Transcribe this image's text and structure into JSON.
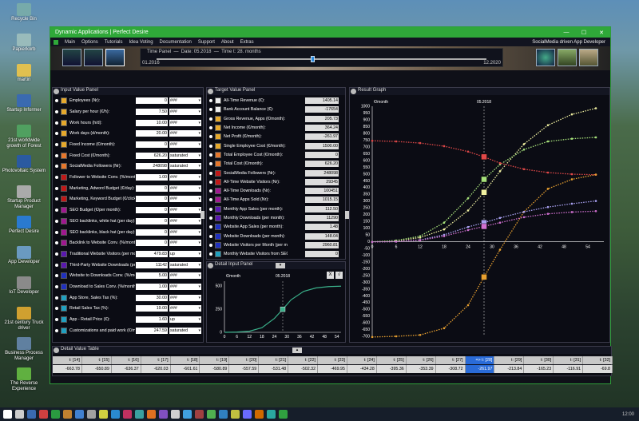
{
  "desktop": {
    "icons": [
      {
        "label": "Recycle Bin",
        "color": "#7aa"
      },
      {
        "label": "Papierkorb",
        "color": "#9bb"
      },
      {
        "label": "martin",
        "color": "#e0c050"
      },
      {
        "label": "Startup Informer",
        "color": "#3a6ab0"
      },
      {
        "label": "21st worldwide growth of Forest",
        "color": "#50a060"
      },
      {
        "label": "Photovoltaic System",
        "color": "#2a5aa0"
      },
      {
        "label": "Startup Product Manager",
        "color": "#aaa"
      },
      {
        "label": "Perfect Desire",
        "color": "#2a7ad0"
      },
      {
        "label": "App Developer",
        "color": "#6a9ac0"
      },
      {
        "label": "IoT Developer",
        "color": "#8a8a8a"
      },
      {
        "label": "21st century Truck driver",
        "color": "#d0a030"
      },
      {
        "label": "Business Process Manager",
        "color": "#6080a0"
      },
      {
        "label": "The Reverse Experience",
        "color": "#60b040"
      }
    ]
  },
  "window": {
    "title": "Dynamic Applications | Perfect Desire",
    "controls": {
      "min": "—",
      "max": "☐",
      "close": "✕"
    }
  },
  "menu": {
    "items": [
      "Main",
      "Options",
      "Tutorials",
      "Idea Voting",
      "Documentation",
      "Support",
      "About",
      "Extras"
    ],
    "right": "SocialMedia driven App Developer"
  },
  "timepanel": {
    "title": "Time Panel",
    "date_label": "Date: 05.2018",
    "time_label": "Time t: 28. months",
    "start": "01.2016",
    "end": "12.2020",
    "progress": 0.47
  },
  "input_panel": {
    "title": "Input Value Panel",
    "rows": [
      {
        "label": "Employees (Nr):",
        "value": "0",
        "select": "###",
        "color": "#e6a92c"
      },
      {
        "label": "Salary per hour (€/h):",
        "value": "7.50",
        "select": "###",
        "color": "#e6a92c"
      },
      {
        "label": "Work hours (h/d):",
        "value": "10.00",
        "select": "###",
        "color": "#e6a92c"
      },
      {
        "label": "Work days (d/month):",
        "value": "20.00",
        "select": "###",
        "color": "#e6a92c"
      },
      {
        "label": "Fixed Income (€/month):",
        "value": "0",
        "select": "###",
        "color": "#e6a92c"
      },
      {
        "label": "Fixed Cost (€/month):",
        "value": "626.20",
        "select": "saturated",
        "color": "#e6772c"
      },
      {
        "label": "SocialMedia Followers (Nr):",
        "value": "248098",
        "select": "saturated",
        "color": "#e6772c"
      },
      {
        "label": "Follower to Website Conv. (%/month):",
        "value": "1.00",
        "select": "###",
        "color": "#c01818"
      },
      {
        "label": "Marketing, Adword Budget (€/day):",
        "value": "0",
        "select": "###",
        "color": "#c01818"
      },
      {
        "label": "Marketing, Keyword Budget (€/click):",
        "value": "0",
        "select": "###",
        "color": "#c01818"
      },
      {
        "label": "SEO Budget (€/per month):",
        "value": "0",
        "select": "###",
        "color": "#a01890"
      },
      {
        "label": "SEO backlinks, white hat (per day):",
        "value": "0",
        "select": "###",
        "color": "#a01890"
      },
      {
        "label": "SEO backlinks, black hat (per day):",
        "value": "0",
        "select": "###",
        "color": "#a01890"
      },
      {
        "label": "Backlink to Website Conv. (%/month):",
        "value": "0",
        "select": "###",
        "color": "#a01890"
      },
      {
        "label": "Traditional Website Visitors (per month):",
        "value": "479.83",
        "select": "up",
        "color": "#5a18b0"
      },
      {
        "label": "Third-Party Website Downloads (per month):",
        "value": "11142",
        "select": "saturated",
        "color": "#5a18b0"
      },
      {
        "label": "Website to Downloads Conv. (%/month):",
        "value": "5.00",
        "select": "###",
        "color": "#2030c0"
      },
      {
        "label": "Download to Sales Conv. (%/month):",
        "value": "1.00",
        "select": "###",
        "color": "#2030c0"
      },
      {
        "label": "App Store, Sales Tax (%):",
        "value": "30.00",
        "select": "###",
        "color": "#20a0c0"
      },
      {
        "label": "Retail Sales Tax (%):",
        "value": "19.00",
        "select": "###",
        "color": "#20a0c0"
      },
      {
        "label": "App - Retail Price (€):",
        "value": "1.60",
        "select": "up",
        "color": "#20a0c0"
      },
      {
        "label": "Customizations and paid work (€/month):",
        "value": "247.59",
        "select": "saturated",
        "color": "#20a0c0"
      }
    ]
  },
  "target_panel": {
    "title": "Target Value Panel",
    "rows": [
      {
        "label": "All-Time Revenue (€):",
        "value": "1405.14",
        "color": "#eeeeee"
      },
      {
        "label": "Bank Account Balance (€):",
        "value": "-17654",
        "color": "#eeeeee"
      },
      {
        "label": "Gross Revenue, Apps (€/month):",
        "value": "205.73",
        "color": "#e6a92c"
      },
      {
        "label": "Net Income (€/month):",
        "value": "364.24",
        "color": "#e6a92c"
      },
      {
        "label": "Net Profit (€/month):",
        "value": "-261.97",
        "color": "#e6a92c"
      },
      {
        "label": "Single Employee Cost (€/month):",
        "value": "1500.00",
        "color": "#e6a92c"
      },
      {
        "label": "Total Employee Cost (€/month):",
        "value": "0",
        "color": "#e6772c"
      },
      {
        "label": "Total Cost (€/month):",
        "value": "626.20",
        "color": "#e6772c"
      },
      {
        "label": "SocialMedia Followers (Nr):",
        "value": "248098",
        "color": "#c01818"
      },
      {
        "label": "All-Time Website Visitors (Nr):",
        "value": "29345",
        "color": "#c01818"
      },
      {
        "label": "All-Time Downloads (Nr):",
        "value": "100451",
        "color": "#a01890"
      },
      {
        "label": "All-Time Apps Sold (Nr):",
        "value": "1015.15",
        "color": "#a01890"
      },
      {
        "label": "Monthly App Sales (per month):",
        "value": "112.50",
        "color": "#5a18b0"
      },
      {
        "label": "Monthly Downloads (per month):",
        "value": "11290",
        "color": "#5a18b0"
      },
      {
        "label": "Website App Sales (per month):",
        "value": "1.48",
        "color": "#2030c0"
      },
      {
        "label": "Website Downloads (per month):",
        "value": "148.04",
        "color": "#2030c0"
      },
      {
        "label": "Website Visitors per Month (per month):",
        "value": "2960.81",
        "color": "#2030c0"
      },
      {
        "label": "Monthly Website Visitors from SEO (Nr):",
        "value": "0",
        "color": "#20a0c0"
      }
    ]
  },
  "detail_input_panel": {
    "title": "Detail Input Panel",
    "ylabel": "€/month",
    "marker_label": "05.2018",
    "x_ticks": [
      "0",
      "6",
      "12",
      "18",
      "24",
      "30",
      "36",
      "42",
      "48",
      "54"
    ],
    "y_ticks": [
      "500",
      "250",
      "0"
    ],
    "btn_x": "X",
    "btn_check": "√"
  },
  "result_graph": {
    "title": "Result Graph",
    "ylabel": "€/month",
    "marker_label": "05.2018",
    "y_ticks": [
      "1000",
      "950",
      "900",
      "850",
      "800",
      "750",
      "700",
      "650",
      "600",
      "550",
      "500",
      "450",
      "400",
      "350",
      "300",
      "250",
      "200",
      "150",
      "100",
      "50",
      "0",
      "-50",
      "-100",
      "-150",
      "-200",
      "-250",
      "-300",
      "-350",
      "-400",
      "-450",
      "-500",
      "-550",
      "-600",
      "-650",
      "-700"
    ],
    "x_ticks": [
      "0",
      "6",
      "12",
      "18",
      "24",
      "30",
      "36",
      "42",
      "48",
      "54"
    ]
  },
  "detail_table": {
    "title": "Detail Value Table",
    "headers": [
      "t: [14]",
      "t: [15]",
      "t: [16]",
      "t: [17]",
      "t: [18]",
      "t: [19]",
      "t: [20]",
      "t: [21]",
      "t: [22]",
      "t: [23]",
      "t: [24]",
      "t: [25]",
      "t: [26]",
      "t: [27]",
      "=> t: [28]",
      "t: [29]",
      "t: [30]",
      "t: [31]",
      "t: [32]"
    ],
    "values": [
      "-663.78",
      "-650.89",
      "-636.37",
      "-620.03",
      "-601.61",
      "-580.89",
      "-557.59",
      "-531.48",
      "-502.32",
      "-469.95",
      "-434.28",
      "-395.36",
      "-353.39",
      "-308.72",
      "-261.97",
      "-213.84",
      "-165.23",
      "-116.91",
      "-69.8"
    ],
    "highlight_index": 14
  },
  "chart_data": {
    "type": "line",
    "title": "Result Graph",
    "ylabel": "€/month",
    "xlabel": "",
    "ylim": [
      -700,
      1000
    ],
    "xlim": [
      0,
      58
    ],
    "marker_x": 28,
    "series": [
      {
        "color": "#f0f0a0",
        "points": [
          [
            0,
            -2
          ],
          [
            6,
            5
          ],
          [
            12,
            30
          ],
          [
            18,
            90
          ],
          [
            24,
            230
          ],
          [
            28,
            364
          ],
          [
            32,
            520
          ],
          [
            38,
            720
          ],
          [
            44,
            860
          ],
          [
            50,
            940
          ],
          [
            56,
            985
          ]
        ]
      },
      {
        "color": "#a6e07a",
        "points": [
          [
            0,
            -2
          ],
          [
            6,
            8
          ],
          [
            12,
            40
          ],
          [
            18,
            140
          ],
          [
            24,
            320
          ],
          [
            28,
            460
          ],
          [
            32,
            570
          ],
          [
            38,
            680
          ],
          [
            44,
            740
          ],
          [
            50,
            760
          ],
          [
            56,
            770
          ]
        ]
      },
      {
        "color": "#e04848",
        "points": [
          [
            0,
            745
          ],
          [
            6,
            740
          ],
          [
            12,
            728
          ],
          [
            18,
            705
          ],
          [
            24,
            665
          ],
          [
            28,
            626
          ],
          [
            32,
            580
          ],
          [
            38,
            535
          ],
          [
            44,
            510
          ],
          [
            50,
            498
          ],
          [
            56,
            494
          ]
        ]
      },
      {
        "color": "#e8a030",
        "points": [
          [
            0,
            -705
          ],
          [
            6,
            -700
          ],
          [
            12,
            -690
          ],
          [
            18,
            -640
          ],
          [
            24,
            -470
          ],
          [
            28,
            -262
          ],
          [
            32,
            -60
          ],
          [
            38,
            220
          ],
          [
            44,
            390
          ],
          [
            50,
            460
          ],
          [
            56,
            495
          ]
        ]
      },
      {
        "color": "#a8a0f0",
        "points": [
          [
            0,
            -3
          ],
          [
            6,
            0
          ],
          [
            12,
            12
          ],
          [
            18,
            50
          ],
          [
            24,
            108
          ],
          [
            28,
            140
          ],
          [
            32,
            175
          ],
          [
            38,
            220
          ],
          [
            44,
            255
          ],
          [
            50,
            280
          ],
          [
            56,
            300
          ]
        ]
      },
      {
        "color": "#d070d0",
        "points": [
          [
            0,
            -3
          ],
          [
            6,
            0
          ],
          [
            12,
            10
          ],
          [
            18,
            40
          ],
          [
            24,
            85
          ],
          [
            28,
            112
          ],
          [
            32,
            140
          ],
          [
            38,
            180
          ],
          [
            44,
            205
          ],
          [
            50,
            218
          ],
          [
            56,
            225
          ]
        ]
      }
    ]
  },
  "detail_chart": {
    "type": "line",
    "ylim": [
      0,
      550
    ],
    "xlim": [
      0,
      56
    ],
    "marker_x": 28,
    "points": [
      [
        0,
        0
      ],
      [
        6,
        3
      ],
      [
        12,
        12
      ],
      [
        18,
        50
      ],
      [
        24,
        150
      ],
      [
        28,
        248
      ],
      [
        32,
        350
      ],
      [
        38,
        440
      ],
      [
        44,
        478
      ],
      [
        50,
        492
      ],
      [
        56,
        496
      ]
    ]
  },
  "taskbar": {
    "clock": "12:00"
  }
}
